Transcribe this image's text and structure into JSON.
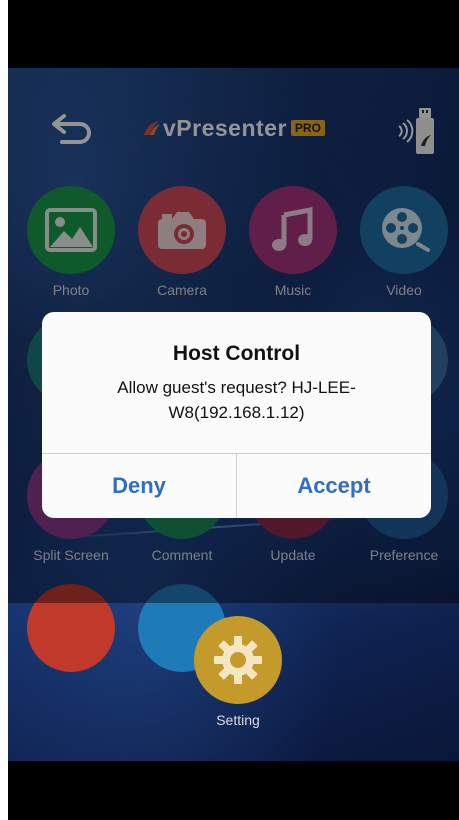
{
  "header": {
    "logo_text": "vPresenter",
    "logo_badge": "PRO"
  },
  "apps": {
    "row1": [
      {
        "label": "Photo",
        "icon": "photo-icon",
        "color": "#1a9c4a"
      },
      {
        "label": "Camera",
        "icon": "camera-icon",
        "color": "#d24a5a"
      },
      {
        "label": "Music",
        "icon": "music-note-icon",
        "color": "#a7357f"
      },
      {
        "label": "Video",
        "icon": "film-reel-icon",
        "color": "#1f6fa8"
      }
    ],
    "row3": [
      {
        "label": "Split Screen"
      },
      {
        "label": "Comment"
      },
      {
        "label": "Update"
      },
      {
        "label": "Preference"
      }
    ],
    "setting": {
      "label": "Setting",
      "icon": "gear-icon",
      "color": "#c49a2b"
    }
  },
  "dialog": {
    "title": "Host Control",
    "message": "Allow guest's request? HJ-LEE-W8(192.168.1.12)",
    "deny": "Deny",
    "accept": "Accept",
    "button_color": "#2e6fc2"
  }
}
